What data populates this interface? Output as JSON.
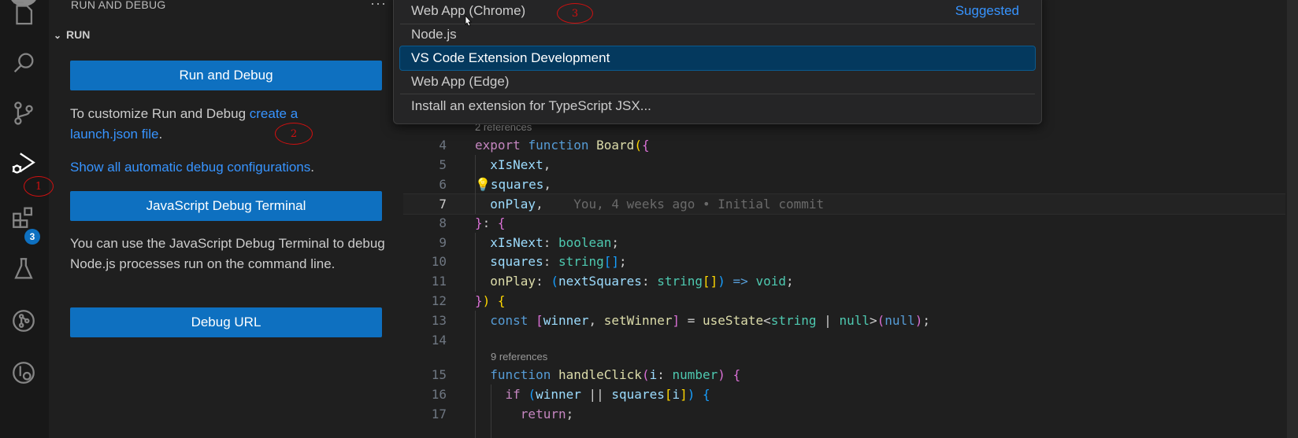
{
  "activity_bar": {
    "icons": [
      "explorer-icon",
      "search-icon",
      "source-control-icon",
      "run-debug-icon",
      "extensions-icon",
      "testing-icon",
      "git-graph-icon",
      "remote-icon"
    ],
    "extensions_badge": "3"
  },
  "sidebar": {
    "title": "RUN AND DEBUG",
    "more": "···",
    "section": "RUN",
    "run_button": "Run and Debug",
    "customize_prefix": "To customize Run and Debug ",
    "customize_link_1": "create a",
    "customize_link_2": "launch.json file",
    "customize_suffix": ".",
    "show_all_link": "Show all automatic debug configurations",
    "show_all_suffix": ".",
    "js_terminal_button": "JavaScript Debug Terminal",
    "js_terminal_desc": "You can use the JavaScript Debug Terminal to debug Node.js processes run on the command line.",
    "debug_url_button": "Debug URL"
  },
  "quick_pick": {
    "items": [
      {
        "label": "Web App (Chrome)",
        "detail": "Suggested"
      },
      {
        "label": "Node.js",
        "detail": ""
      },
      {
        "label": "VS Code Extension Development",
        "detail": ""
      },
      {
        "label": "Web App (Edge)",
        "detail": ""
      },
      {
        "label": "Install an extension for TypeScript JSX...",
        "detail": ""
      }
    ],
    "selected_index": 2
  },
  "editor": {
    "refs_1": "2 references",
    "refs_2": "9 references",
    "blame": "You, 4 weeks ago • Initial commit",
    "line_numbers": [
      "4",
      "5",
      "6",
      "7",
      "8",
      "9",
      "10",
      "11",
      "12",
      "13",
      "14",
      "15",
      "16",
      "17"
    ]
  },
  "annotations": {
    "marker_1": "1",
    "marker_2": "2",
    "marker_3": "3"
  },
  "colors": {
    "accent": "#0e70c0",
    "link": "#3794ff",
    "selection": "#04395e",
    "annotation": "#d01010"
  }
}
